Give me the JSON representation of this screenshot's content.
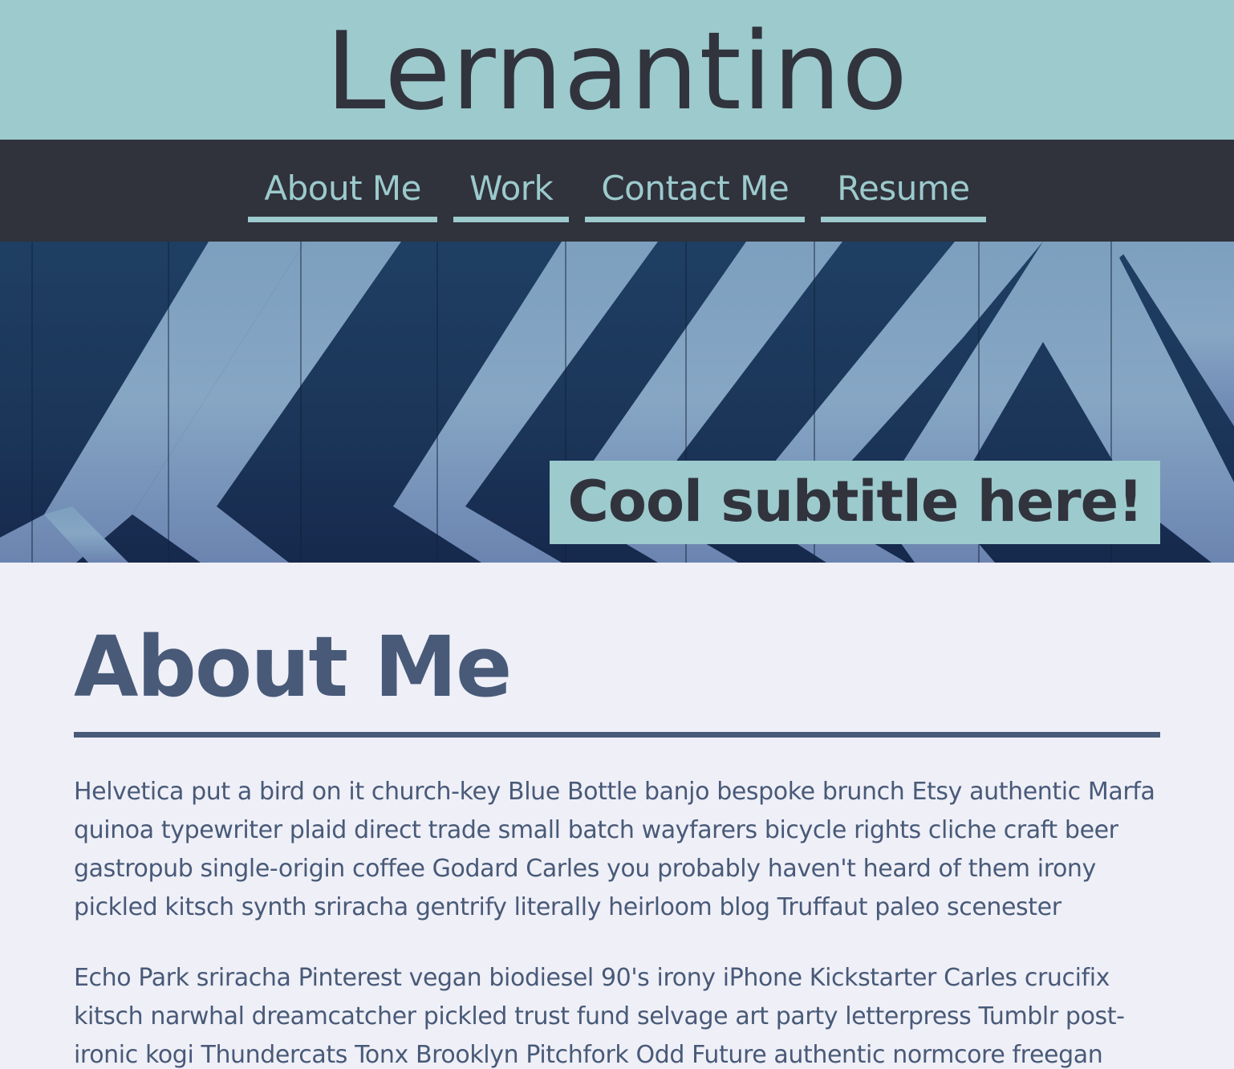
{
  "header": {
    "title": "Lernantino"
  },
  "nav": {
    "items": [
      {
        "label": "About Me"
      },
      {
        "label": "Work"
      },
      {
        "label": "Contact Me"
      },
      {
        "label": "Resume"
      }
    ]
  },
  "hero": {
    "subtitle": "Cool subtitle here!",
    "image_description": "blue painted wooden planks with chevron pattern"
  },
  "about": {
    "heading": "About Me",
    "paragraphs": [
      "Helvetica put a bird on it church-key Blue Bottle banjo bespoke brunch Etsy authentic Marfa quinoa typewriter plaid direct trade small batch wayfarers bicycle rights cliche craft beer gastropub single-origin coffee Godard Carles you probably haven't heard of them irony pickled kitsch synth sriracha gentrify literally heirloom blog Truffaut paleo scenester",
      "Echo Park sriracha Pinterest vegan biodiesel 90's irony iPhone Kickstarter Carles crucifix kitsch narwhal dreamcatcher pickled trust fund selvage art party letterpress Tumblr post-ironic kogi Thundercats Tonx Brooklyn Pitchfork Odd Future authentic normcore freegan"
    ]
  },
  "colors": {
    "header_bg": "#9ccacd",
    "nav_bg": "#30323c",
    "accent": "#9ccacd",
    "text_dark": "#31333d",
    "heading_blue": "#485a78",
    "page_bg": "#efeff7"
  }
}
